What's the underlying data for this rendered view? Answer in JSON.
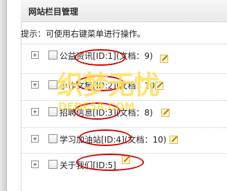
{
  "panel": {
    "title": "网站栏目管理",
    "tip": "提示：可使用右键菜单进行操作。"
  },
  "watermark": {
    "main": "织梦无忧",
    "sub": "DEDE58.COM"
  },
  "tree": [
    {
      "label": "公益资讯[ID:1](文档：9)",
      "has_checkbox": true
    },
    {
      "label": "小作文集[ID:2](文档：10)",
      "has_checkbox": true
    },
    {
      "label": "招聘信息[ID:3](文档：8)",
      "has_checkbox": true
    },
    {
      "label": "学习加油站[ID:4](文档：10)",
      "has_checkbox": true
    },
    {
      "label": "关于我们[ID:5]",
      "has_checkbox": true
    }
  ]
}
